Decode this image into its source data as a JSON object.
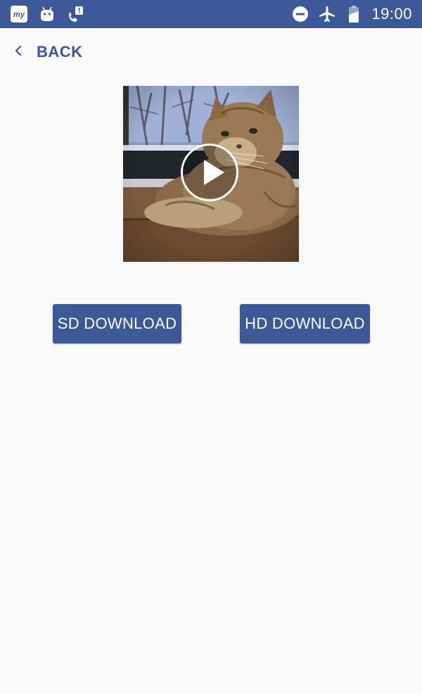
{
  "status_bar": {
    "time": "19:00",
    "left_icons": [
      "myapp-notification-icon",
      "android-robot-icon",
      "missed-call-icon"
    ],
    "right_icons": [
      "do-not-disturb-icon",
      "airplane-mode-icon",
      "battery-icon"
    ],
    "background_color": "#3b5998"
  },
  "nav": {
    "back_label": "BACK"
  },
  "video": {
    "thumbnail_subject": "cat",
    "play_icon": "play-icon"
  },
  "actions": {
    "sd_label": "SD DOWNLOAD",
    "hd_label": "HD DOWNLOAD"
  },
  "colors": {
    "accent": "#3b5998",
    "background": "#f9f9f9"
  }
}
